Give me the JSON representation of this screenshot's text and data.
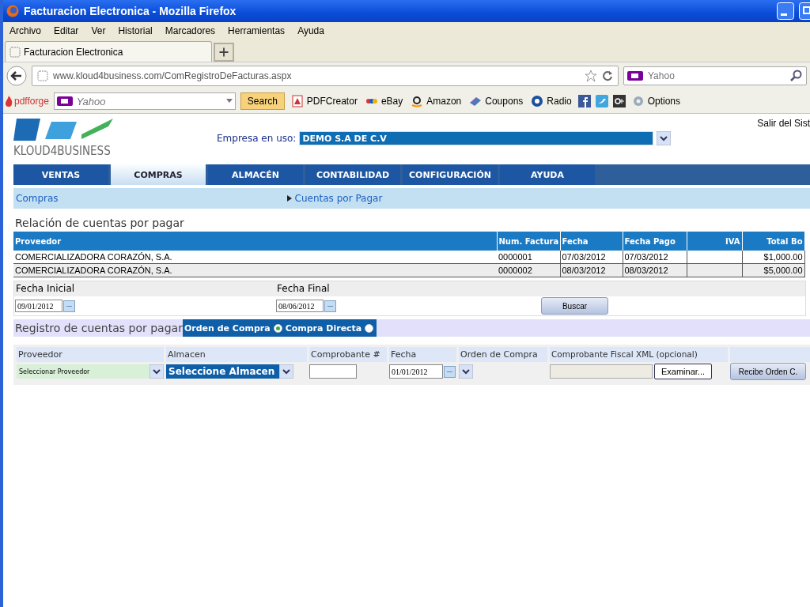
{
  "window": {
    "title": "Facturacion Electronica - Mozilla Firefox"
  },
  "menu": [
    "Archivo",
    "Editar",
    "Ver",
    "Historial",
    "Marcadores",
    "Herramientas",
    "Ayuda"
  ],
  "browser_tabs": [
    {
      "label": "Facturacion Electronica",
      "selected": true
    }
  ],
  "address_bar": {
    "value": "www.kloud4business.com/ComRegistroDeFacturas.aspx"
  },
  "search_box": {
    "placeholder": "Yahoo"
  },
  "toolbar": {
    "brand": "pdfforge",
    "search_placeholder": "Yahoo",
    "search_button": "Search",
    "items": [
      {
        "label": "PDFCreator",
        "kind": "pdf"
      },
      {
        "label": "eBay",
        "kind": "ebay"
      },
      {
        "label": "Amazon",
        "kind": "amazon"
      },
      {
        "label": "Coupons",
        "kind": "coupons"
      },
      {
        "label": "Radio",
        "kind": "radio"
      },
      {
        "label": "Options",
        "kind": "options"
      }
    ]
  },
  "page": {
    "logo": "KLOUD4BUSINESS",
    "company_label": "Empresa en uso:",
    "company_value": "DEMO S.A DE C.V",
    "logout": "Salir del Sist",
    "nav": [
      {
        "label": "VENTAS",
        "selected": false
      },
      {
        "label": "COMPRAS",
        "selected": true
      },
      {
        "label": "ALMACÉN",
        "selected": false
      },
      {
        "label": "CONTABILIDAD",
        "selected": false
      },
      {
        "label": "CONFIGURACIÓN",
        "selected": false
      },
      {
        "label": "AYUDA",
        "selected": false
      }
    ],
    "breadcrumb": {
      "section": "Compras",
      "current": "Cuentas por Pagar"
    },
    "list_title": "Relación de cuentas por pagar",
    "table": {
      "columns": [
        "Proveedor",
        "Num. Factura",
        "Fecha",
        "Fecha Pago",
        "IVA",
        "Total Bo"
      ],
      "rows": [
        [
          "COMERCIALIZADORA CORAZÓN, S.A.",
          "0000001",
          "07/03/2012",
          "07/03/2012",
          "",
          "$1,000.00"
        ],
        [
          "COMERCIALIZADORA CORAZÓN, S.A.",
          "0000002",
          "08/03/2012",
          "08/03/2012",
          "",
          "$5,000.00"
        ]
      ]
    },
    "filter": {
      "start_label": "Fecha Inicial",
      "start_value": "09/01/2012",
      "end_label": "Fecha Final",
      "end_value": "08/06/2012",
      "button": "Buscar"
    },
    "register": {
      "title": "Registro de cuentas por pagar",
      "options": [
        {
          "label": "Orden de Compra",
          "selected": true
        },
        {
          "label": "Compra Directa",
          "selected": false
        }
      ],
      "columns": [
        "Proveedor",
        "Almacen",
        "Comprobante #",
        "Fecha",
        "Orden de Compra",
        "Comprobante Fiscal XML (opcional)"
      ],
      "proveedor": "Seleccionar Proveedor",
      "almacen": "Seleccione Almacen",
      "fecha": "01/01/2012",
      "browse_button": "Examinar...",
      "submit_button": "Recibe Orden C."
    }
  }
}
